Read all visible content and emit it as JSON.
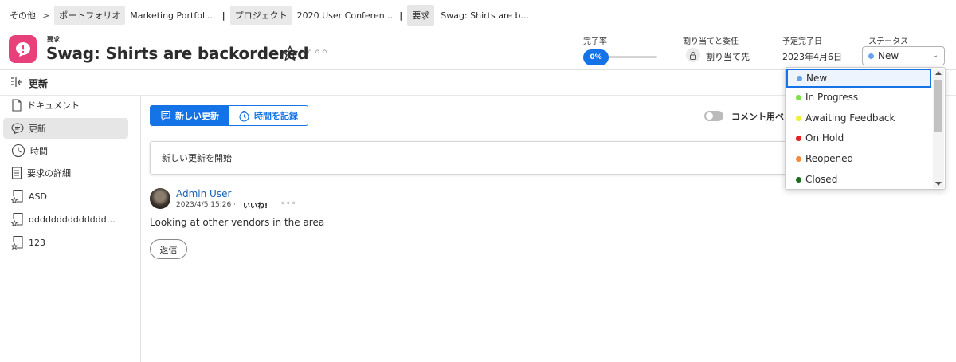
{
  "breadcrumb": {
    "others": "その他",
    "gt": ">",
    "portfolio_chip": "ポートフォリオ",
    "portfolio_name": "Marketing Portfoli...",
    "bar1": "|",
    "project_chip": "プロジェクト",
    "project_name": "2020 User Conferen...",
    "bar2": "|",
    "request_chip": "要求",
    "request_name": "Swag: Shirts are b..."
  },
  "header": {
    "object_type": "要求",
    "title": "Swag: Shirts are backordered",
    "more": "◦◦◦",
    "icon_color": "#e8407a"
  },
  "fields": {
    "completion_label": "完了率",
    "completion_value": "0%",
    "completion_fraction": 0,
    "assign_label": "割り当てと委任",
    "assign_value": "割り当て先",
    "due_label": "予定完了日",
    "due_value": "2023年4月6日",
    "status_label": "ステータス",
    "status_value": "New",
    "status_color": "#6aa1ee"
  },
  "updates_header": "更新",
  "sidebar": {
    "items": [
      {
        "label": "ドキュメント",
        "icon": "document-icon"
      },
      {
        "label": "更新",
        "icon": "comment-icon"
      },
      {
        "label": "時間",
        "icon": "clock-icon"
      },
      {
        "label": "要求の詳細",
        "icon": "details-icon"
      },
      {
        "label": "ASD",
        "icon": "custom-section-icon"
      },
      {
        "label": "dddddddddddddd…",
        "icon": "custom-section-icon"
      },
      {
        "label": "123",
        "icon": "custom-section-icon"
      }
    ]
  },
  "main": {
    "tab_new_update": "新しい更新",
    "tab_log_time": "時間を記録",
    "toggle_label": "コメント用ベ",
    "update_placeholder": "新しい更新を開始",
    "post": {
      "author": "Admin User",
      "timestamp": "2023/4/5 15:26 ·",
      "like": "いいね!",
      "more": "◦◦◦",
      "text": "Looking at other vendors in the area",
      "reply": "返信"
    }
  },
  "status_dropdown": {
    "options": [
      {
        "label": "New",
        "color": "#6aa1ee"
      },
      {
        "label": "In Progress",
        "color": "#7ee04f"
      },
      {
        "label": "Awaiting Feedback",
        "color": "#f2ee3a"
      },
      {
        "label": "On Hold",
        "color": "#e22222"
      },
      {
        "label": "Reopened",
        "color": "#f08a3c"
      },
      {
        "label": "Closed",
        "color": "#1d6b1d"
      }
    ]
  },
  "colors": {
    "accent": "#1473e6",
    "link": "#1a5fb4"
  }
}
